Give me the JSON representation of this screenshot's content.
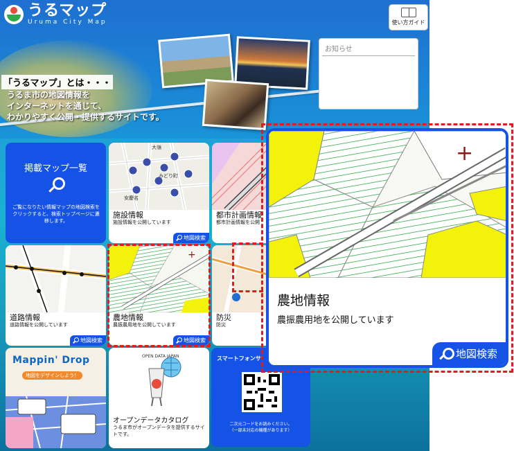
{
  "header": {
    "logo_title": "うるマップ",
    "logo_subtitle": "Uruma City Map",
    "guide_button": "使い方ガイド"
  },
  "notice": {
    "title": "お知らせ"
  },
  "intro": {
    "heading": "「うるマップ」とは・・・",
    "lines": [
      "うるま市の地図情報を",
      "インターネットを通じて、",
      "わかりやすく公開・提供するサイトです。"
    ]
  },
  "map_list": {
    "title": "掲載マップ一覧",
    "description": "ご覧になりたい情報マップの地図検索をクリックすると、検索トップページに遷移します。"
  },
  "tiles": [
    {
      "title": "施設情報",
      "description": "施設情報を公開しています",
      "search_label": "地図検索"
    },
    {
      "title": "都市計画情報",
      "description": "都市計画情報を公開"
    },
    {
      "title": "道路情報",
      "description": "道路情報を公開しています",
      "search_label": "地図検索"
    },
    {
      "title": "農地情報",
      "description": "農振農用地を公開しています",
      "search_label": "地図検索"
    },
    {
      "title": "防災",
      "description": "防災"
    }
  ],
  "map_labels": [
    "大嶺",
    "みどり町",
    "安慶名"
  ],
  "mappin_drop": {
    "logo": "Mappin' Drop",
    "subtitle": "地図をデザインしよう！"
  },
  "open_data": {
    "badge": "OPEN DATA JAPAN",
    "title": "オープンデータカタログ",
    "description": "うるま市がオープンデータを提供するサイトです。"
  },
  "smartphone": {
    "title": "スマートフォンサ",
    "note": "二次元コードをお読みください。\n（一部未対応の機種があります）"
  },
  "zoom": {
    "title": "農地情報",
    "description": "農振農用地を公開しています",
    "search_label": "地図検索"
  },
  "colors": {
    "brand_blue": "#1553e6",
    "highlight_red": "#e01d1d",
    "farmland_yellow": "#f2f20a",
    "farmland_green": "#2fa84a"
  }
}
